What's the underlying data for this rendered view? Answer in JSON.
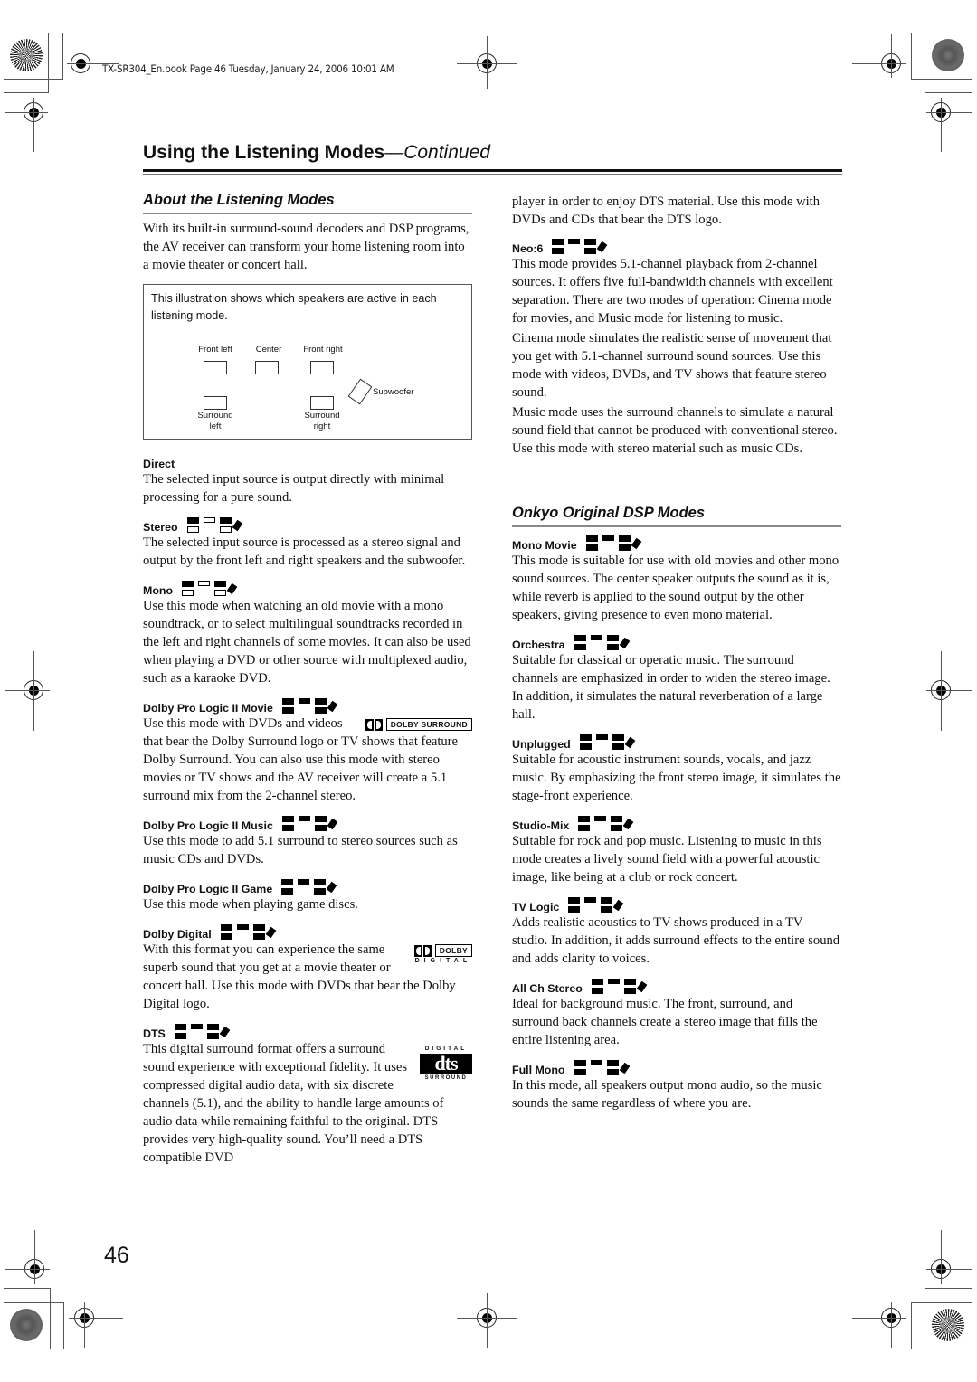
{
  "header_note": "TX-SR304_En.book  Page 46  Tuesday, January 24, 2006  10:01 AM",
  "page_title": {
    "main": "Using the Listening Modes",
    "suffix": "—Continued"
  },
  "page_number": "46",
  "left": {
    "section_title": "About the Listening Modes",
    "intro": "With its built-in surround-sound decoders and DSP programs, the AV receiver can transform your home listening room into a movie theater or concert hall.",
    "illustration": {
      "caption": "This illustration shows which speakers are active in each listening mode.",
      "labels": {
        "front_left": "Front left",
        "center": "Center",
        "front_right": "Front right",
        "subwoofer": "Subwoofer",
        "surround_left": [
          "Surround",
          "left"
        ],
        "surround_right": [
          "Surround",
          "right"
        ]
      }
    },
    "modes": [
      {
        "title": "Direct",
        "text": "The selected input source is output directly with minimal processing for a pure sound.",
        "speakers": null
      },
      {
        "title": "Stereo",
        "text": "The selected input source is processed as a stereo signal and output by the front left and right speakers and the subwoofer.",
        "speakers": {
          "fl": true,
          "c": false,
          "fr": true,
          "sl": false,
          "sr": false,
          "sw": true
        }
      },
      {
        "title": "Mono",
        "text": "Use this mode when watching an old movie with a mono soundtrack, or to select multilingual soundtracks recorded in the left and right channels of some movies. It can also be used when playing a DVD or other source with multiplexed audio, such as a karaoke DVD.",
        "speakers": {
          "fl": true,
          "c": false,
          "fr": true,
          "sl": false,
          "sr": false,
          "sw": true
        }
      },
      {
        "title": "Dolby Pro Logic II Movie",
        "text": "Use this mode with DVDs and videos that bear the Dolby Surround logo or TV shows that feature Dolby Surround. You can also use this mode with stereo movies or TV shows and the AV receiver will create a 5.1 surround mix from the 2-channel stereo.",
        "speakers": {
          "fl": true,
          "c": true,
          "fr": true,
          "sl": true,
          "sr": true,
          "sw": true
        },
        "logo": "DOLBY SURROUND"
      },
      {
        "title": "Dolby Pro Logic II Music",
        "text": "Use this mode to add 5.1 surround to stereo sources such as music CDs and DVDs.",
        "speakers": {
          "fl": true,
          "c": true,
          "fr": true,
          "sl": true,
          "sr": true,
          "sw": true
        }
      },
      {
        "title": "Dolby Pro Logic II Game",
        "text": "Use this mode when playing game discs.",
        "speakers": {
          "fl": true,
          "c": true,
          "fr": true,
          "sl": true,
          "sr": true,
          "sw": true
        }
      },
      {
        "title": "Dolby Digital",
        "text": "With this format you can experience the same superb sound that you get at a movie theater or concert hall. Use this mode with DVDs that bear the Dolby Digital logo.",
        "speakers": {
          "fl": true,
          "c": true,
          "fr": true,
          "sl": true,
          "sr": true,
          "sw": true
        },
        "logo": {
          "box": "DOLBY",
          "sub": "DIGITAL"
        }
      },
      {
        "title": "DTS",
        "text": "This digital surround format offers a surround sound experience with exceptional fidelity. It uses compressed digital audio data, with six discrete channels (5.1), and the ability to handle large amounts of audio data while remaining faithful to the original. DTS provides very high-quality sound. You’ll need a DTS compatible DVD",
        "speakers": {
          "fl": true,
          "c": true,
          "fr": true,
          "sl": true,
          "sr": true,
          "sw": true
        },
        "logo": {
          "top": "DIGITAL",
          "mark": "dts",
          "bottom": "SURROUND"
        }
      }
    ]
  },
  "right": {
    "continued_text": "player in order to enjoy DTS material. Use this mode with DVDs and CDs that bear the DTS logo.",
    "neo6": {
      "title": "Neo:6",
      "speakers": {
        "fl": true,
        "c": true,
        "fr": true,
        "sl": true,
        "sr": true,
        "sw": true
      },
      "paragraphs": [
        "This mode provides 5.1-channel playback from 2-channel sources. It offers five full-bandwidth channels with excellent separation. There are two modes of operation: Cinema mode for movies, and Music mode for listening to music.",
        "Cinema mode simulates the realistic sense of movement that you get with 5.1-channel surround sound sources. Use this mode with videos, DVDs, and TV shows that feature stereo sound.",
        "Music mode uses the surround channels to simulate a natural sound field that cannot be produced with conventional stereo. Use this mode with stereo material such as music CDs."
      ]
    },
    "section_title": "Onkyo Original DSP Modes",
    "modes": [
      {
        "title": "Mono Movie",
        "text": "This mode is suitable for use with old movies and other mono sound sources. The center speaker outputs the sound as it is, while reverb is applied to the sound output by the other speakers, giving presence to even mono material.",
        "speakers": {
          "fl": true,
          "c": true,
          "fr": true,
          "sl": true,
          "sr": true,
          "sw": true
        }
      },
      {
        "title": "Orchestra",
        "text": "Suitable for classical or operatic music. The surround channels are emphasized in order to widen the stereo image. In addition, it simulates the natural reverberation of a large hall.",
        "speakers": {
          "fl": true,
          "c": true,
          "fr": true,
          "sl": true,
          "sr": true,
          "sw": true
        }
      },
      {
        "title": "Unplugged",
        "text": "Suitable for acoustic instrument sounds, vocals, and jazz music. By emphasizing the front stereo image, it simulates the stage-front experience.",
        "speakers": {
          "fl": true,
          "c": true,
          "fr": true,
          "sl": true,
          "sr": true,
          "sw": true
        }
      },
      {
        "title": "Studio-Mix",
        "text": "Suitable for rock and pop music. Listening to music in this mode creates a lively sound field with a powerful acoustic image, like being at a club or rock concert.",
        "speakers": {
          "fl": true,
          "c": true,
          "fr": true,
          "sl": true,
          "sr": true,
          "sw": true
        }
      },
      {
        "title": "TV Logic",
        "text": "Adds realistic acoustics to TV shows produced in a TV studio. In addition, it adds surround effects to the entire sound and adds clarity to voices.",
        "speakers": {
          "fl": true,
          "c": true,
          "fr": true,
          "sl": true,
          "sr": true,
          "sw": true
        }
      },
      {
        "title": "All Ch Stereo",
        "text": "Ideal for background music. The front, surround, and surround back channels create a stereo image that fills the entire listening area.",
        "speakers": {
          "fl": true,
          "c": true,
          "fr": true,
          "sl": true,
          "sr": true,
          "sw": true
        }
      },
      {
        "title": "Full Mono",
        "text": "In this mode, all speakers output mono audio, so the music sounds the same regardless of where you are.",
        "speakers": {
          "fl": true,
          "c": true,
          "fr": true,
          "sl": true,
          "sr": true,
          "sw": true
        }
      }
    ]
  }
}
